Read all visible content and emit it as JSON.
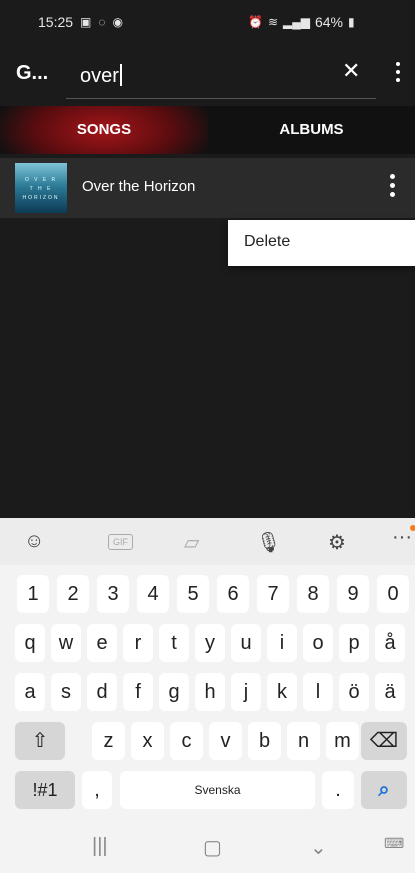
{
  "status": {
    "time": "15:25",
    "battery": "64%"
  },
  "appbar": {
    "title": "G...",
    "search_value": "over",
    "clear": "✕"
  },
  "tabs": [
    {
      "label": "SONGS",
      "active": true
    },
    {
      "label": "ALBUMS",
      "active": false
    }
  ],
  "song": {
    "title": "Over the Horizon",
    "art_text": [
      "O V E R",
      "T H E",
      "HORIZON"
    ]
  },
  "popup": {
    "item": "Delete"
  },
  "keyboard": {
    "toolbar_gif": "GIF",
    "row_numbers": [
      "1",
      "2",
      "3",
      "4",
      "5",
      "6",
      "7",
      "8",
      "9",
      "0"
    ],
    "row1": [
      "q",
      "w",
      "e",
      "r",
      "t",
      "y",
      "u",
      "i",
      "o",
      "p",
      "å"
    ],
    "row2": [
      "a",
      "s",
      "d",
      "f",
      "g",
      "h",
      "j",
      "k",
      "l",
      "ö",
      "ä"
    ],
    "row3": [
      "z",
      "x",
      "c",
      "v",
      "b",
      "n",
      "m"
    ],
    "symbols": "!#1",
    "comma": ",",
    "space": "Svenska",
    "period": ".",
    "accent_color": "#1e73d8"
  }
}
